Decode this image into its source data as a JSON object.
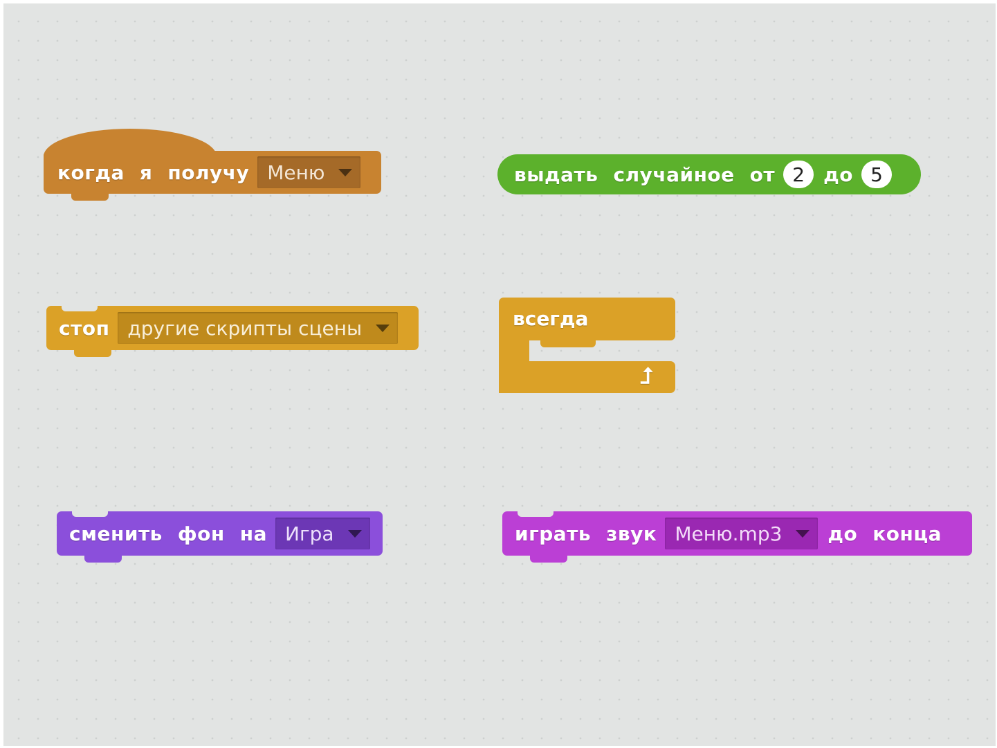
{
  "blocks": {
    "when_receive": {
      "words": [
        "когда",
        "я",
        "получу"
      ],
      "dropdown": "Меню"
    },
    "pick_random": {
      "words": [
        "выдать",
        "случайное",
        "от"
      ],
      "from": "2",
      "middle": "до",
      "to": "5"
    },
    "stop": {
      "word": "стоп",
      "dropdown": "другие скрипты сцены"
    },
    "forever": {
      "label": "всегда",
      "icon": "loop-arrow-icon"
    },
    "switch_backdrop": {
      "words": [
        "сменить",
        "фон",
        "на"
      ],
      "dropdown": "Игра"
    },
    "play_sound": {
      "words": [
        "играть",
        "звук"
      ],
      "dropdown": "Меню.mp3",
      "tail": [
        "до",
        "конца"
      ]
    }
  },
  "colors": {
    "events": "#c88330",
    "operators": "#5cb12c",
    "control": "#dba127",
    "looks": "#8b4fdb",
    "sound": "#bb3fd5",
    "canvas": "#e2e4e3"
  }
}
